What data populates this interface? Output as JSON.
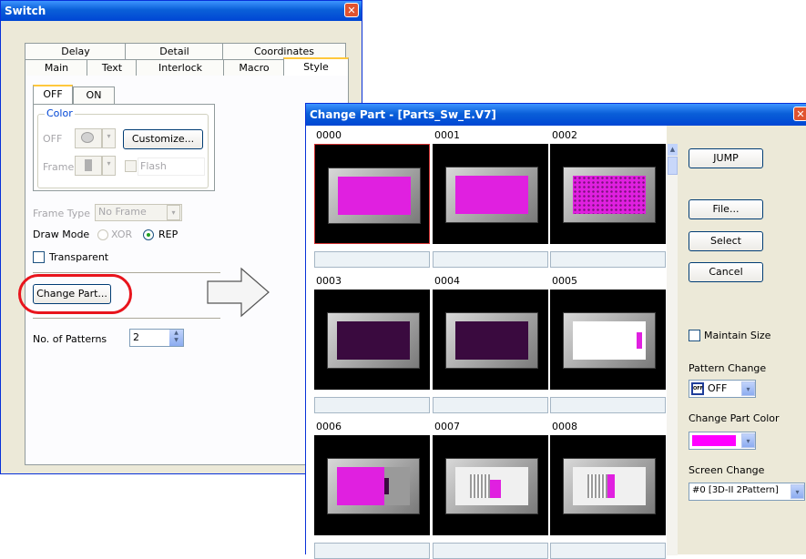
{
  "switch_dialog": {
    "title": "Switch",
    "tabs_row1": [
      "Delay",
      "Detail",
      "Coordinates"
    ],
    "tabs_row2": [
      "Main",
      "Text",
      "Interlock",
      "Macro",
      "Style"
    ],
    "state_tabs": [
      "OFF",
      "ON"
    ],
    "color_group_label": "Color",
    "off_label": "OFF",
    "frame_label": "Frame",
    "customize_button": "Customize...",
    "flash_label": "Flash",
    "frame_type_label": "Frame Type",
    "frame_type_value": "No Frame",
    "draw_mode_label": "Draw Mode",
    "draw_mode_xor": "XOR",
    "draw_mode_rep": "REP",
    "transparent_label": "Transparent",
    "change_part_button": "Change Part...",
    "patterns_label": "No. of Patterns",
    "patterns_value": "2"
  },
  "change_part_dialog": {
    "title": "Change Part - [Parts_Sw_E.V7]",
    "parts": [
      {
        "id": "0000",
        "style": "flat-magenta"
      },
      {
        "id": "0001",
        "style": "flat-magenta"
      },
      {
        "id": "0002",
        "style": "dotted-magenta"
      },
      {
        "id": "0003",
        "style": "dark-purple"
      },
      {
        "id": "0004",
        "style": "dark-purple"
      },
      {
        "id": "0005",
        "style": "white-slide"
      },
      {
        "id": "0006",
        "style": "magenta-slide"
      },
      {
        "id": "0007",
        "style": "striped-toggle"
      },
      {
        "id": "0008",
        "style": "striped-toggle-2"
      }
    ],
    "jump_button": "JUMP",
    "file_button": "File...",
    "select_button": "Select",
    "cancel_button": "Cancel",
    "maintain_size_label": "Maintain Size",
    "pattern_change_label": "Pattern Change",
    "pattern_change_value": "OFF",
    "pattern_icon_text": "OFF",
    "change_part_color_label": "Change Part Color",
    "change_part_color": "#ff00ff",
    "screen_change_label": "Screen Change",
    "screen_change_value": "#0 [3D-II 2Pattern]"
  },
  "colors": {
    "accent": "#0a5fd8",
    "highlight_oval": "#e8141c",
    "magenta": "#e020e0",
    "dark_purple": "#3a0a3f"
  }
}
